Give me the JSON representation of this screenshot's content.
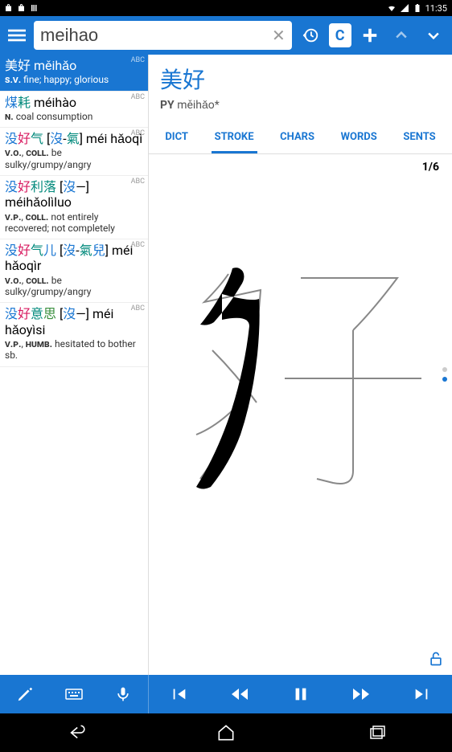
{
  "status": {
    "time": "11:35"
  },
  "search": {
    "value": "meihao"
  },
  "cardLabel": "C",
  "entries": [
    {
      "tag": "ABC",
      "hw_html": "<span class='c-m'>美</span><span class='c-m'>好</span> měihǎo",
      "def_html": "<span class='pos'>s.v.</span> fine; happy; glorious",
      "sel": true
    },
    {
      "tag": "ABC",
      "hw_html": "<span class='c-b'>煤</span><span class='c-t'>耗</span> méihào",
      "def_html": "<span class='pos'>n.</span> coal consumption"
    },
    {
      "tag": "ABC",
      "hw_html": "<span class='c-b'>没</span><span class='c-m'>好</span><span class='c-t'>气</span> [<span class='c-b'>沒</span>-<span class='c-t'>氣</span>] méi hǎoqì",
      "def_html": "<span class='pos'>v.o.</span>, <span class='pos'>coll.</span> be sulky/grumpy/angry"
    },
    {
      "tag": "ABC",
      "hw_html": "<span class='c-b'>没</span><span class='c-m'>好</span><span class='c-t'>利</span><span class='c-t'>落</span> [<span class='c-b'>沒</span>—] méihǎolìluo",
      "def_html": "<span class='pos'>v.p.</span>, <span class='pos'>coll.</span> not entirely recovered; not completely"
    },
    {
      "tag": "ABC",
      "hw_html": "<span class='c-b'>没</span><span class='c-m'>好</span><span class='c-t'>气</span><span class='c-b'>儿</span> [<span class='c-b'>沒</span>-<span class='c-t'>氣</span><span class='c-b'>兒</span>] méi hǎoqìr",
      "def_html": "<span class='pos'>v.o.</span>, <span class='pos'>coll.</span> be sulky/grumpy/angry"
    },
    {
      "tag": "ABC",
      "hw_html": "<span class='c-b'>没</span><span class='c-m'>好</span><span class='c-t'>意</span><span class='c-g'>思</span> [<span class='c-b'>沒</span>—] méi hǎoyìsi",
      "def_html": "<span class='pos'>v.p.</span>, <span class='pos'>humb.</span> hesitated to bother sb."
    }
  ],
  "detail": {
    "headword": "美好",
    "pyLabel": "PY",
    "pinyin": "měihǎo*",
    "tabs": [
      "DICT",
      "STROKE",
      "CHARS",
      "WORDS",
      "SENTS"
    ],
    "activeTab": 1,
    "counter": "1/6"
  }
}
